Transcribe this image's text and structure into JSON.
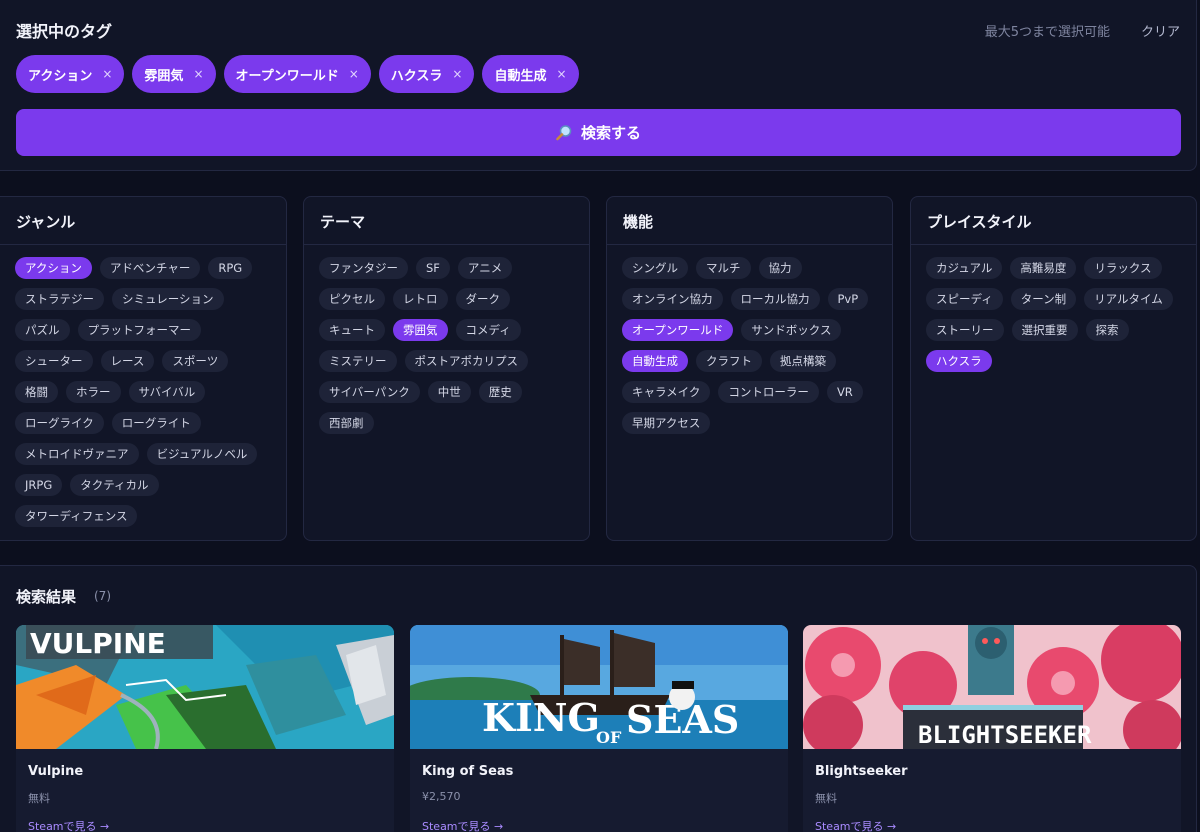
{
  "selected": {
    "title": "選択中のタグ",
    "hint": "最大5つまで選択可能",
    "clear_label": "クリア",
    "remove_glyph": "×",
    "tags": [
      "アクション",
      "雰囲気",
      "オープンワールド",
      "ハクスラ",
      "自動生成"
    ],
    "search_label": "検索する",
    "search_icon": "magnifier-icon"
  },
  "categories": [
    {
      "title": "ジャンル",
      "tags": [
        "アクション",
        "アドベンチャー",
        "RPG",
        "ストラテジー",
        "シミュレーション",
        "パズル",
        "プラットフォーマー",
        "シューター",
        "レース",
        "スポーツ",
        "格闘",
        "ホラー",
        "サバイバル",
        "ローグライク",
        "ローグライト",
        "メトロイドヴァニア",
        "ビジュアルノベル",
        "JRPG",
        "タクティカル",
        "タワーディフェンス"
      ],
      "active": [
        "アクション"
      ]
    },
    {
      "title": "テーマ",
      "tags": [
        "ファンタジー",
        "SF",
        "アニメ",
        "ピクセル",
        "レトロ",
        "ダーク",
        "キュート",
        "雰囲気",
        "コメディ",
        "ミステリー",
        "ポストアポカリプス",
        "サイバーパンク",
        "中世",
        "歴史",
        "西部劇"
      ],
      "active": [
        "雰囲気"
      ]
    },
    {
      "title": "機能",
      "tags": [
        "シングル",
        "マルチ",
        "協力",
        "オンライン協力",
        "ローカル協力",
        "PvP",
        "オープンワールド",
        "サンドボックス",
        "自動生成",
        "クラフト",
        "拠点構築",
        "キャラメイク",
        "コントローラー",
        "VR",
        "早期アクセス"
      ],
      "active": [
        "オープンワールド",
        "自動生成"
      ]
    },
    {
      "title": "プレイスタイル",
      "tags": [
        "カジュアル",
        "高難易度",
        "リラックス",
        "スピーディ",
        "ターン制",
        "リアルタイム",
        "ストーリー",
        "選択重要",
        "探索",
        "ハクスラ"
      ],
      "active": [
        "ハクスラ"
      ]
    }
  ],
  "results": {
    "title": "検索結果",
    "count": "(7)",
    "items": [
      {
        "name": "Vulpine",
        "price": "無料",
        "link": "Steamで見る →",
        "banner": "VULPINE"
      },
      {
        "name": "King of Seas",
        "price": "¥2,570",
        "link": "Steamで見る →",
        "banner_top": "KING",
        "banner_mid": "OF",
        "banner_bot": "SEAS"
      },
      {
        "name": "Blightseeker",
        "price": "無料",
        "link": "Steamで見る →",
        "banner": "BLIGHTSEEKER"
      }
    ]
  },
  "colors": {
    "accent": "#7b3aed",
    "background": "#0c0f1e",
    "panel": "#111527",
    "tag": "#1e2338"
  }
}
